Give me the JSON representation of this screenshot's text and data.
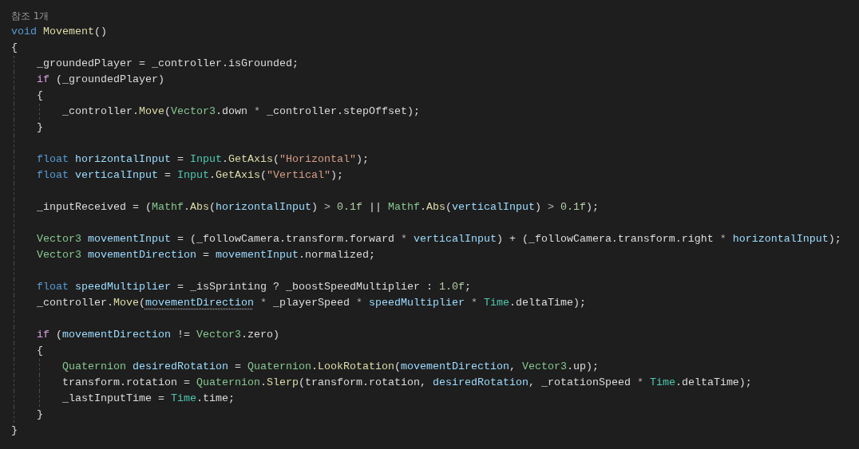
{
  "codelens": "참조 1개",
  "lines": [
    {
      "kind": "code",
      "tokens": [
        {
          "text": "void ",
          "kind": "keyword"
        },
        {
          "text": "Movement",
          "kind": "method"
        },
        {
          "text": "()",
          "kind": "plain"
        }
      ]
    },
    {
      "kind": "code",
      "tokens": [
        {
          "text": "{",
          "kind": "plain"
        }
      ],
      "children": [
        {
          "kind": "code",
          "tokens": [
            {
              "text": "_groundedPlayer = _controller.isGrounded;",
              "kind": "plain"
            }
          ]
        },
        {
          "kind": "code",
          "tokens": [
            {
              "text": "if",
              "kind": "control"
            },
            {
              "text": " (_groundedPlayer)",
              "kind": "plain"
            }
          ]
        },
        {
          "kind": "code",
          "tokens": [
            {
              "text": "{",
              "kind": "plain"
            }
          ],
          "children": [
            {
              "kind": "code",
              "tokens": [
                {
                  "text": "_controller.",
                  "kind": "plain"
                },
                {
                  "text": "Move",
                  "kind": "method"
                },
                {
                  "text": "(",
                  "kind": "plain"
                },
                {
                  "text": "Vector3",
                  "kind": "struct"
                },
                {
                  "text": ".down ",
                  "kind": "plain"
                },
                {
                  "text": "*",
                  "kind": "operator"
                },
                {
                  "text": " _controller.stepOffset);",
                  "kind": "plain"
                }
              ]
            }
          ]
        },
        {
          "kind": "code",
          "tokens": [
            {
              "text": "}",
              "kind": "plain"
            }
          ]
        },
        {
          "kind": "blank"
        },
        {
          "kind": "code",
          "tokens": [
            {
              "text": "float ",
              "kind": "keyword"
            },
            {
              "text": "horizontalInput",
              "kind": "local"
            },
            {
              "text": " = ",
              "kind": "plain"
            },
            {
              "text": "Input",
              "kind": "class"
            },
            {
              "text": ".",
              "kind": "plain"
            },
            {
              "text": "GetAxis",
              "kind": "method"
            },
            {
              "text": "(",
              "kind": "plain"
            },
            {
              "text": "\"Horizontal\"",
              "kind": "string"
            },
            {
              "text": ");",
              "kind": "plain"
            }
          ]
        },
        {
          "kind": "code",
          "tokens": [
            {
              "text": "float ",
              "kind": "keyword"
            },
            {
              "text": "verticalInput",
              "kind": "local"
            },
            {
              "text": " = ",
              "kind": "plain"
            },
            {
              "text": "Input",
              "kind": "class"
            },
            {
              "text": ".",
              "kind": "plain"
            },
            {
              "text": "GetAxis",
              "kind": "method"
            },
            {
              "text": "(",
              "kind": "plain"
            },
            {
              "text": "\"Vertical\"",
              "kind": "string"
            },
            {
              "text": ");",
              "kind": "plain"
            }
          ]
        },
        {
          "kind": "blank"
        },
        {
          "kind": "code",
          "tokens": [
            {
              "text": "_inputReceived = (",
              "kind": "plain"
            },
            {
              "text": "Mathf",
              "kind": "struct"
            },
            {
              "text": ".",
              "kind": "plain"
            },
            {
              "text": "Abs",
              "kind": "method"
            },
            {
              "text": "(",
              "kind": "plain"
            },
            {
              "text": "horizontalInput",
              "kind": "local"
            },
            {
              "text": ") ",
              "kind": "plain"
            },
            {
              "text": "> ",
              "kind": "operator"
            },
            {
              "text": "0.1f",
              "kind": "number"
            },
            {
              "text": " || ",
              "kind": "plain"
            },
            {
              "text": "Mathf",
              "kind": "struct"
            },
            {
              "text": ".",
              "kind": "plain"
            },
            {
              "text": "Abs",
              "kind": "method"
            },
            {
              "text": "(",
              "kind": "plain"
            },
            {
              "text": "verticalInput",
              "kind": "local"
            },
            {
              "text": ") ",
              "kind": "plain"
            },
            {
              "text": "> ",
              "kind": "operator"
            },
            {
              "text": "0.1f",
              "kind": "number"
            },
            {
              "text": ");",
              "kind": "plain"
            }
          ]
        },
        {
          "kind": "blank"
        },
        {
          "kind": "code",
          "tokens": [
            {
              "text": "Vector3 ",
              "kind": "struct"
            },
            {
              "text": "movementInput",
              "kind": "local"
            },
            {
              "text": " = (_followCamera.transform.forward ",
              "kind": "plain"
            },
            {
              "text": "* ",
              "kind": "operator"
            },
            {
              "text": "verticalInput",
              "kind": "local"
            },
            {
              "text": ") + (_followCamera.transform.right ",
              "kind": "plain"
            },
            {
              "text": "* ",
              "kind": "operator"
            },
            {
              "text": "horizontalInput",
              "kind": "local"
            },
            {
              "text": ");",
              "kind": "plain"
            }
          ]
        },
        {
          "kind": "code",
          "tokens": [
            {
              "text": "Vector3 ",
              "kind": "struct"
            },
            {
              "text": "movementDirection",
              "kind": "local"
            },
            {
              "text": " = ",
              "kind": "plain"
            },
            {
              "text": "movementInput",
              "kind": "local"
            },
            {
              "text": ".normalized;",
              "kind": "plain"
            }
          ]
        },
        {
          "kind": "blank"
        },
        {
          "kind": "code",
          "tokens": [
            {
              "text": "float ",
              "kind": "keyword"
            },
            {
              "text": "speedMultiplier",
              "kind": "local"
            },
            {
              "text": " = _isSprinting ? _boostSpeedMultiplier : ",
              "kind": "plain"
            },
            {
              "text": "1.0f",
              "kind": "number"
            },
            {
              "text": ";",
              "kind": "plain"
            }
          ]
        },
        {
          "kind": "code",
          "tokens": [
            {
              "text": "_controller.",
              "kind": "plain"
            },
            {
              "text": "Move",
              "kind": "method"
            },
            {
              "text": "(",
              "kind": "plain"
            },
            {
              "text": "movementDirection",
              "kind": "local",
              "suggestion": true
            },
            {
              "text": " * ",
              "kind": "operator"
            },
            {
              "text": "_playerSpeed ",
              "kind": "plain"
            },
            {
              "text": "* ",
              "kind": "operator"
            },
            {
              "text": "speedMultiplier",
              "kind": "local"
            },
            {
              "text": " * ",
              "kind": "operator"
            },
            {
              "text": "Time",
              "kind": "class"
            },
            {
              "text": ".deltaTime);",
              "kind": "plain"
            }
          ]
        },
        {
          "kind": "blank"
        },
        {
          "kind": "code",
          "tokens": [
            {
              "text": "if",
              "kind": "control"
            },
            {
              "text": " (",
              "kind": "plain"
            },
            {
              "text": "movementDirection",
              "kind": "local"
            },
            {
              "text": " != ",
              "kind": "plain"
            },
            {
              "text": "Vector3",
              "kind": "struct"
            },
            {
              "text": ".zero)",
              "kind": "plain"
            }
          ]
        },
        {
          "kind": "code",
          "tokens": [
            {
              "text": "{",
              "kind": "plain"
            }
          ],
          "children": [
            {
              "kind": "code",
              "tokens": [
                {
                  "text": "Quaternion ",
                  "kind": "struct"
                },
                {
                  "text": "desiredRotation",
                  "kind": "local"
                },
                {
                  "text": " = ",
                  "kind": "plain"
                },
                {
                  "text": "Quaternion",
                  "kind": "struct"
                },
                {
                  "text": ".",
                  "kind": "plain"
                },
                {
                  "text": "LookRotation",
                  "kind": "method"
                },
                {
                  "text": "(",
                  "kind": "plain"
                },
                {
                  "text": "movementDirection",
                  "kind": "local"
                },
                {
                  "text": ", ",
                  "kind": "plain"
                },
                {
                  "text": "Vector3",
                  "kind": "struct"
                },
                {
                  "text": ".up);",
                  "kind": "plain"
                }
              ]
            },
            {
              "kind": "code",
              "tokens": [
                {
                  "text": "transform.rotation = ",
                  "kind": "plain"
                },
                {
                  "text": "Quaternion",
                  "kind": "struct"
                },
                {
                  "text": ".",
                  "kind": "plain"
                },
                {
                  "text": "Slerp",
                  "kind": "method"
                },
                {
                  "text": "(transform.rotation, ",
                  "kind": "plain"
                },
                {
                  "text": "desiredRotation",
                  "kind": "local"
                },
                {
                  "text": ", _rotationSpeed ",
                  "kind": "plain"
                },
                {
                  "text": "* ",
                  "kind": "operator"
                },
                {
                  "text": "Time",
                  "kind": "class"
                },
                {
                  "text": ".deltaTime);",
                  "kind": "plain"
                }
              ]
            },
            {
              "kind": "code",
              "tokens": [
                {
                  "text": "_lastInputTime = ",
                  "kind": "plain"
                },
                {
                  "text": "Time",
                  "kind": "class"
                },
                {
                  "text": ".time;",
                  "kind": "plain"
                }
              ]
            }
          ]
        },
        {
          "kind": "code",
          "tokens": [
            {
              "text": "}",
              "kind": "plain"
            }
          ]
        }
      ]
    },
    {
      "kind": "code",
      "tokens": [
        {
          "text": "}",
          "kind": "plain"
        }
      ]
    }
  ]
}
